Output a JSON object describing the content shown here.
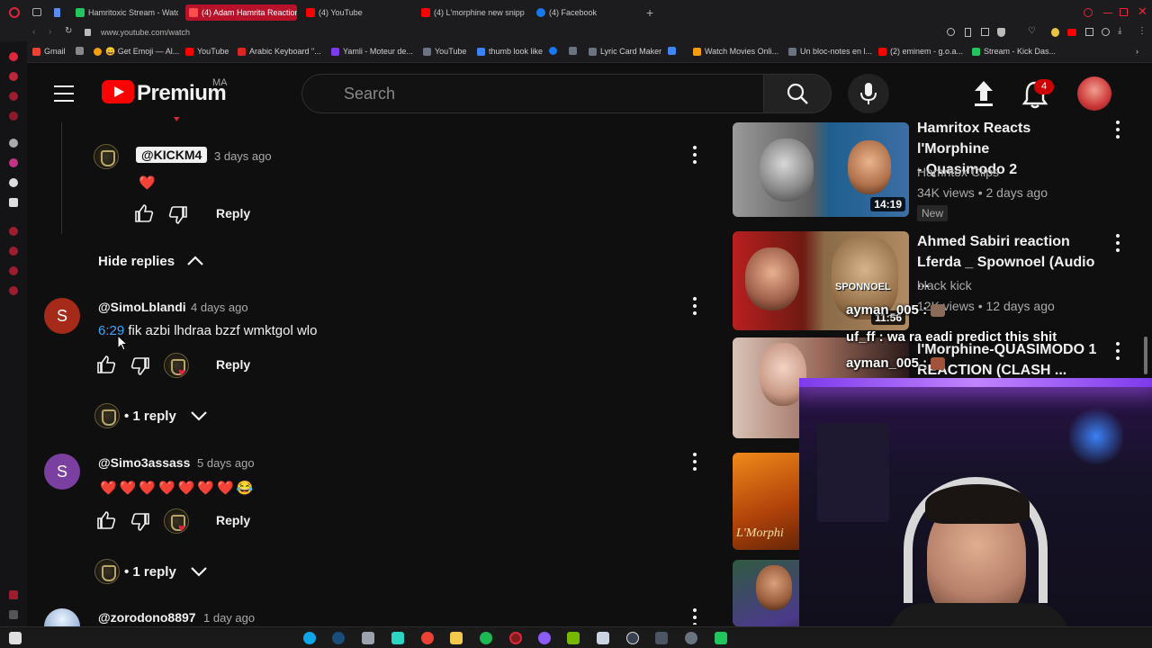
{
  "browser": {
    "tabs": [
      {
        "label": "Hamritoxic Stream - Watch",
        "active": false,
        "color": "#22c55e"
      },
      {
        "label": "(4) Adam Hamrita Reaction",
        "active": true,
        "color": "#ff0000"
      },
      {
        "label": "(4) YouTube",
        "active": false,
        "color": "#ff0000"
      },
      {
        "label": "(4) L'morphine new snipp",
        "active": false,
        "color": "#ff0000"
      },
      {
        "label": "(4) Facebook",
        "active": false,
        "color": "#1877f2"
      }
    ],
    "url": "www.youtube.com/watch",
    "bookmarks": [
      {
        "label": "Gmail",
        "color": "#ea4335"
      },
      {
        "label": "😀 Get Emoji — Al...",
        "color": "#f59e0b"
      },
      {
        "label": "YouTube",
        "color": "#ff0000"
      },
      {
        "label": "Arabic Keyboard \"...",
        "color": "#dc2626"
      },
      {
        "label": "Yamli - Moteur de...",
        "color": "#7c3aed"
      },
      {
        "label": "YouTube",
        "color": "#6b7280"
      },
      {
        "label": "thumb look like",
        "color": "#3b82f6"
      },
      {
        "label": "Lyric Card Maker",
        "color": "#6b7280"
      },
      {
        "label": "Watch Movies Onli...",
        "color": "#f59e0b"
      },
      {
        "label": "Un bloc-notes en l...",
        "color": "#6b7280"
      },
      {
        "label": "(2) eminem - g.o.a...",
        "color": "#ff0000"
      },
      {
        "label": "Stream - Kick Das...",
        "color": "#22c55e"
      }
    ]
  },
  "header": {
    "brand": "Premium",
    "country": "MA",
    "search_placeholder": "Search",
    "notification_count": "4"
  },
  "comments": {
    "reply_label": "Reply",
    "hide_replies_label": "Hide replies",
    "kick_reply": {
      "tag": "@KICKM4",
      "time": "3 days ago",
      "text": "❤️"
    },
    "items": [
      {
        "author": "@SimoLblandi",
        "time": "4 days ago",
        "avatar_letter": "S",
        "avatar_color": "#a52a1a",
        "timestamp_link": "6:29",
        "text": " fik azbi lhdraa bzzf wmktgol wlo",
        "replies": "1 reply"
      },
      {
        "author": "@Simo3assass",
        "time": "5 days ago",
        "avatar_letter": "S",
        "avatar_color": "#7b3fa0",
        "text": "❤️❤️❤️❤️❤️❤️❤️😂",
        "replies": "1 reply"
      },
      {
        "author": "@zorodono8897",
        "time": "1 day ago"
      }
    ]
  },
  "sidebar": {
    "videos": [
      {
        "title_line1": "Hamritox Reacts l'Morphine",
        "title_line2": "- Quasimodo 2",
        "channel": "Hamritox Clips",
        "meta": "34K views • 2 days ago",
        "duration": "14:19",
        "badge": "New"
      },
      {
        "title_line1": "Ahmed Sabiri reaction",
        "title_line2": "Lferda _ Spownoel (Audio ...",
        "channel": "black kick",
        "meta": "12K views • 12 days ago",
        "duration": "11:56"
      },
      {
        "title_line1": "l'Morphine-QUASIMODO 1",
        "title_line2": "REACTION (CLASH ..."
      }
    ]
  },
  "overlay": {
    "chat": [
      {
        "name": "ayman_005 :",
        "text": ""
      },
      {
        "name": "uf_ff :",
        "text": " wa ra eadi predict this shit"
      },
      {
        "name": "ayman_005 :",
        "text": ""
      }
    ]
  }
}
